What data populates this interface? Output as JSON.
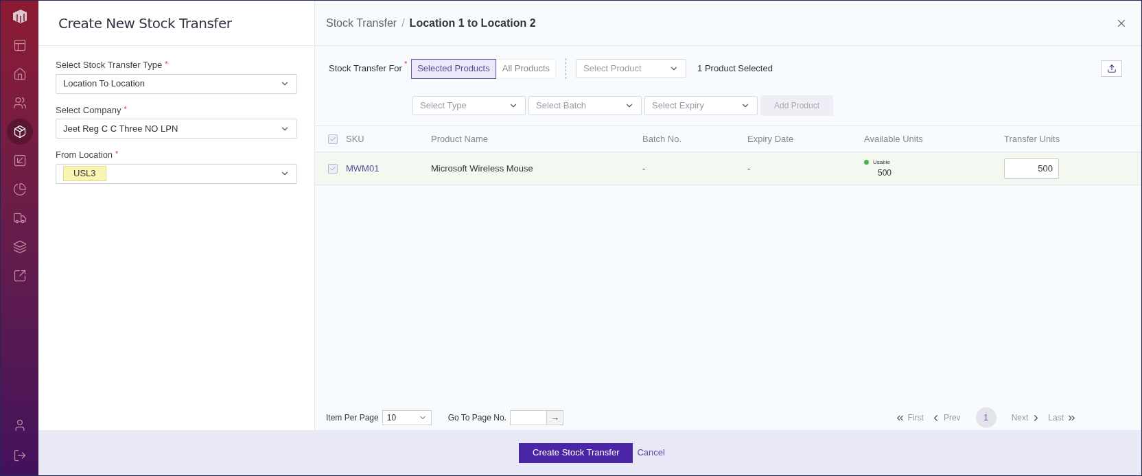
{
  "sidebar": {
    "items": [
      {
        "selected": false
      },
      {
        "selected": false
      },
      {
        "selected": false
      },
      {
        "selected": true
      },
      {
        "selected": false
      },
      {
        "selected": false
      },
      {
        "selected": false
      },
      {
        "selected": false
      },
      {
        "selected": false
      }
    ]
  },
  "left_panel": {
    "title": "Create New Stock Transfer",
    "fields": [
      {
        "label": "Select Stock Transfer Type",
        "required_mark": "*",
        "value": "Location To Location",
        "highlighted": false
      },
      {
        "label": "Select Company",
        "required_mark": "*",
        "value": "Jeet Reg C C Three NO LPN",
        "highlighted": false
      },
      {
        "label": "From Location",
        "required_mark": "*",
        "value": "USL3",
        "highlighted": true
      }
    ]
  },
  "breadcrumb": {
    "parent": "Stock Transfer",
    "separator": "/",
    "current": "Location 1 to Location 2"
  },
  "transfer_for": {
    "label": "Stock Transfer For",
    "required_mark": "*",
    "options": [
      {
        "label": "Selected Products",
        "selected": true
      },
      {
        "label": "All Products",
        "selected": false
      }
    ],
    "product_select": {
      "placeholder": "Select Product"
    },
    "selection_count": "1 Product Selected"
  },
  "filters": [
    {
      "placeholder": "Select Type"
    },
    {
      "placeholder": "Select Batch"
    },
    {
      "placeholder": "Select Expiry"
    }
  ],
  "add_button": {
    "label": "Add Product",
    "disabled": true
  },
  "table": {
    "all_checked": true,
    "columns": [
      "SKU",
      "Product Name",
      "Batch No.",
      "Expiry Date",
      "Available Units",
      "Transfer Units"
    ],
    "rows": [
      {
        "checked": true,
        "sku": "MWM01",
        "product_name": "Microsoft Wireless Mouse",
        "batch": "-",
        "expiry": "-",
        "available": {
          "status": "Usable",
          "color": "#4caf50",
          "units": "500"
        },
        "transfer_units": "500"
      }
    ]
  },
  "pagination": {
    "per_page_label": "Item Per Page",
    "per_page": "10",
    "goto_label": "Go To Page No.",
    "goto_button": "→",
    "nav": [
      {
        "label": "First",
        "kind": "first",
        "disabled": true
      },
      {
        "label": "Prev",
        "kind": "prev",
        "disabled": true
      },
      {
        "label": "1",
        "kind": "page",
        "selected": true
      },
      {
        "label": "Next",
        "kind": "next",
        "disabled": true
      },
      {
        "label": "Last",
        "kind": "last",
        "disabled": true
      }
    ]
  },
  "footer": {
    "submit": "Create Stock Transfer",
    "cancel": "Cancel"
  }
}
